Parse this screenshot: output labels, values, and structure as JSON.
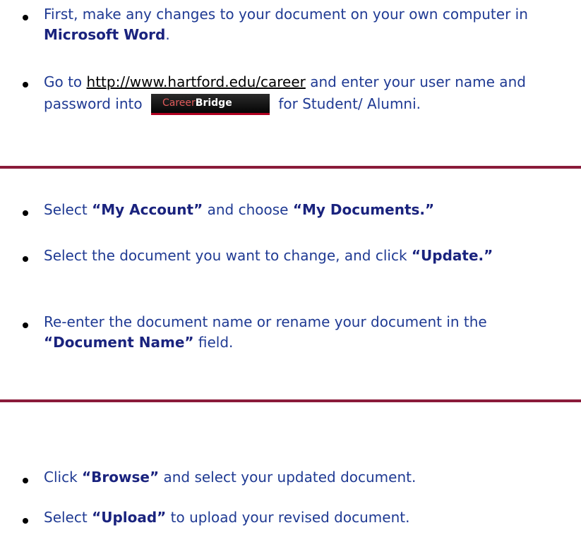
{
  "accent_color": "#8a1b3a",
  "text_color": "#1f3a93",
  "items": [
    {
      "parts": [
        {
          "text": "First, make any changes to your document on your own computer in ",
          "style": "plain"
        },
        {
          "text": "Microsoft Word",
          "style": "strong"
        },
        {
          "text": ".",
          "style": "plain"
        }
      ]
    },
    {
      "parts": [
        {
          "text": "Go to ",
          "style": "plain"
        },
        {
          "text": "http://www.hartford.edu/career",
          "style": "link"
        },
        {
          "text": " and enter your user name and password into ",
          "style": "plain"
        },
        {
          "text": "",
          "style": "logo"
        },
        {
          "text": " for Student/ Alumni.",
          "style": "plain"
        }
      ]
    },
    {
      "parts": [
        {
          "text": "Select ",
          "style": "plain"
        },
        {
          "text": "“My Account”",
          "style": "strong"
        },
        {
          "text": " and choose ",
          "style": "plain"
        },
        {
          "text": "“My Documents.”",
          "style": "strong"
        }
      ]
    },
    {
      "parts": [
        {
          "text": "Select the document you want to change, and click ",
          "style": "plain"
        },
        {
          "text": "“Update.”",
          "style": "strong"
        }
      ]
    },
    {
      "parts": [
        {
          "text": "Re-enter the document name or rename your document in the ",
          "style": "plain"
        },
        {
          "text": "“Document Name”",
          "style": "strong"
        },
        {
          "text": " field.",
          "style": "plain"
        }
      ]
    },
    {
      "parts": [
        {
          "text": "Click ",
          "style": "plain"
        },
        {
          "text": "“Browse”",
          "style": "strong"
        },
        {
          "text": " and select your updated document.",
          "style": "plain"
        }
      ]
    },
    {
      "parts": [
        {
          "text": "Select ",
          "style": "plain"
        },
        {
          "text": "“Upload”",
          "style": "strong"
        },
        {
          "text": " to upload your revised document.",
          "style": "plain"
        }
      ]
    }
  ],
  "logo": {
    "career": "Career",
    "bridge": "Bridge"
  }
}
